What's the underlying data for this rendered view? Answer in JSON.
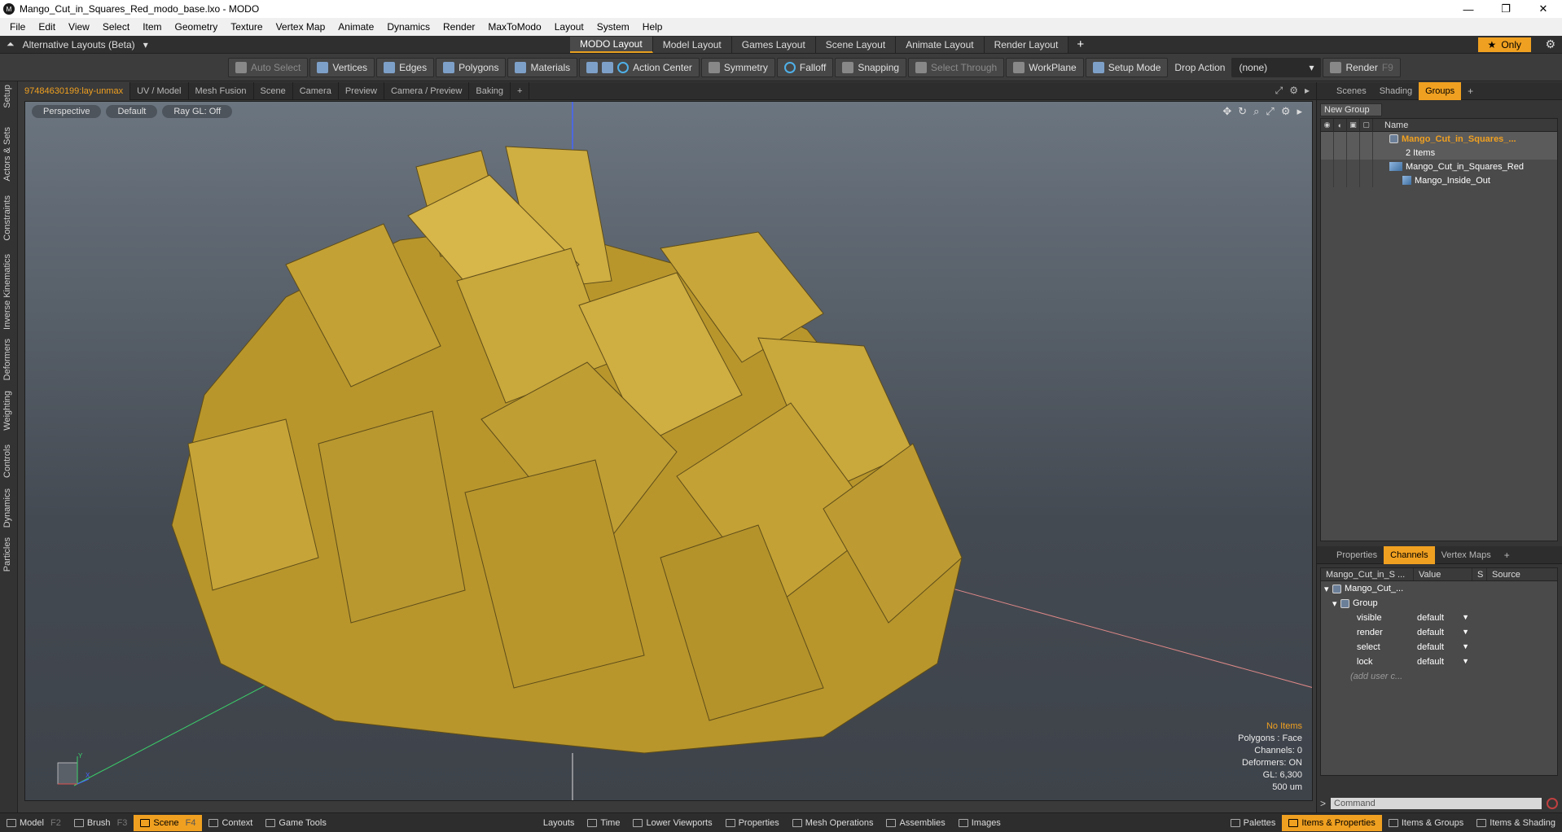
{
  "window": {
    "title": "Mango_Cut_in_Squares_Red_modo_base.lxo - MODO",
    "icon_label": "M",
    "minimize": "—",
    "restore": "❐",
    "close": "✕"
  },
  "menu": [
    "File",
    "Edit",
    "View",
    "Select",
    "Item",
    "Geometry",
    "Texture",
    "Vertex Map",
    "Animate",
    "Dynamics",
    "Render",
    "MaxToModo",
    "Layout",
    "System",
    "Help"
  ],
  "layoutbar": {
    "alt_layouts": "Alternative Layouts (Beta)",
    "tabs": [
      "MODO Layout",
      "Model Layout",
      "Games Layout",
      "Scene Layout",
      "Animate Layout",
      "Render Layout"
    ],
    "active_tab": "MODO Layout",
    "plus": "+",
    "only": "Only"
  },
  "toolbar": {
    "auto_select": "Auto Select",
    "vertices": "Vertices",
    "edges": "Edges",
    "polygons": "Polygons",
    "materials": "Materials",
    "action_center": "Action Center",
    "symmetry": "Symmetry",
    "falloff": "Falloff",
    "snapping": "Snapping",
    "select_through": "Select Through",
    "workplane": "WorkPlane",
    "setup_mode": "Setup Mode",
    "drop_action": "Drop Action",
    "drop_action_value": "(none)",
    "render": "Render",
    "render_key": "F9"
  },
  "left_tabs": [
    "Setup",
    "Actors & Sets",
    "Constraints",
    "Inverse Kinematics",
    "Deformers",
    "Weighting",
    "Controls",
    "Dynamics",
    "Particles"
  ],
  "viewport_tabs": [
    "97484630199:lay-unmax",
    "UV / Model",
    "Mesh Fusion",
    "Scene",
    "Camera",
    "Preview",
    "Camera / Preview",
    "Baking",
    "+"
  ],
  "viewport": {
    "view": "Perspective",
    "shading": "Default",
    "raygl": "Ray GL: Off",
    "stats": {
      "no_items": "No Items",
      "polygons": "Polygons : Face",
      "channels": "Channels: 0",
      "deformers": "Deformers: ON",
      "gl": "GL: 6,300",
      "scale": "500 um"
    },
    "gizmo_y": "Y",
    "gizmo_x": "X"
  },
  "right_panel": {
    "tabs": [
      "Scenes",
      "Shading",
      "Groups"
    ],
    "active_tab": "Groups",
    "new_group": "New Group",
    "name_header": "Name",
    "group_name": "Mango_Cut_in_Squares_...",
    "group_count": "2 Items",
    "items": [
      "Mango_Cut_in_Squares_Red",
      "Mango_Inside_Out"
    ]
  },
  "channels": {
    "tabs": [
      "Properties",
      "Channels",
      "Vertex Maps"
    ],
    "active_tab": "Channels",
    "headers": [
      "Mango_Cut_in_S ...",
      "Value",
      "S",
      "Source"
    ],
    "item_name": "Mango_Cut_...",
    "group_label": "Group",
    "rows": [
      {
        "name": "visible",
        "value": "default"
      },
      {
        "name": "render",
        "value": "default"
      },
      {
        "name": "select",
        "value": "default"
      },
      {
        "name": "lock",
        "value": "default"
      }
    ],
    "add_user": "(add user c..."
  },
  "command": {
    "prompt": ">",
    "placeholder": "Command"
  },
  "bottombar": {
    "left": [
      {
        "label": "Model",
        "key": "F2"
      },
      {
        "label": "Brush",
        "key": "F3"
      },
      {
        "label": "Scene",
        "key": "F4"
      },
      {
        "label": "Context",
        "key": ""
      },
      {
        "label": "Game Tools",
        "key": ""
      }
    ],
    "active": "Scene",
    "center": [
      "Layouts",
      "Time",
      "Lower Viewports",
      "Properties",
      "Mesh Operations",
      "Assemblies",
      "Images"
    ],
    "right": [
      "Palettes",
      "Items & Properties",
      "Items & Groups",
      "Items & Shading"
    ],
    "right_active": "Items & Properties"
  },
  "colors": {
    "accent": "#f0a020",
    "mango": "#c9a53a",
    "mango_dark": "#8f7526"
  }
}
